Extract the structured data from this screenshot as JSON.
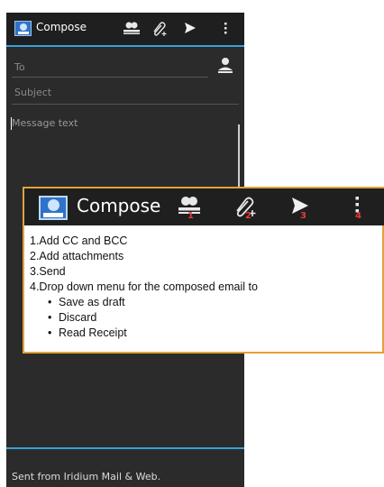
{
  "app": {
    "title": "Compose",
    "icons": [
      "app-logo-icon",
      "add-cc-bcc-icon",
      "attachment-icon",
      "send-icon",
      "overflow-menu-icon"
    ]
  },
  "compose": {
    "to_placeholder": "To",
    "subject_placeholder": "Subject",
    "message_placeholder": "Message text",
    "signature": "Sent from Iridium Mail & Web."
  },
  "callout": {
    "title": "Compose",
    "numbers": [
      "1",
      "2",
      "3",
      "4"
    ],
    "items": [
      "1.Add CC and BCC",
      "2.Add attachments",
      "3.Send",
      "4.Drop down menu for the composed email to"
    ],
    "subitems": [
      "Save as draft",
      "Discard",
      "Read Receipt"
    ],
    "bullet": "•"
  },
  "colors": {
    "accent_blue": "#3aa0d8",
    "callout_border": "#e0a23a",
    "number_red": "#e23b3b",
    "dark_bg": "#2b2b2b"
  }
}
